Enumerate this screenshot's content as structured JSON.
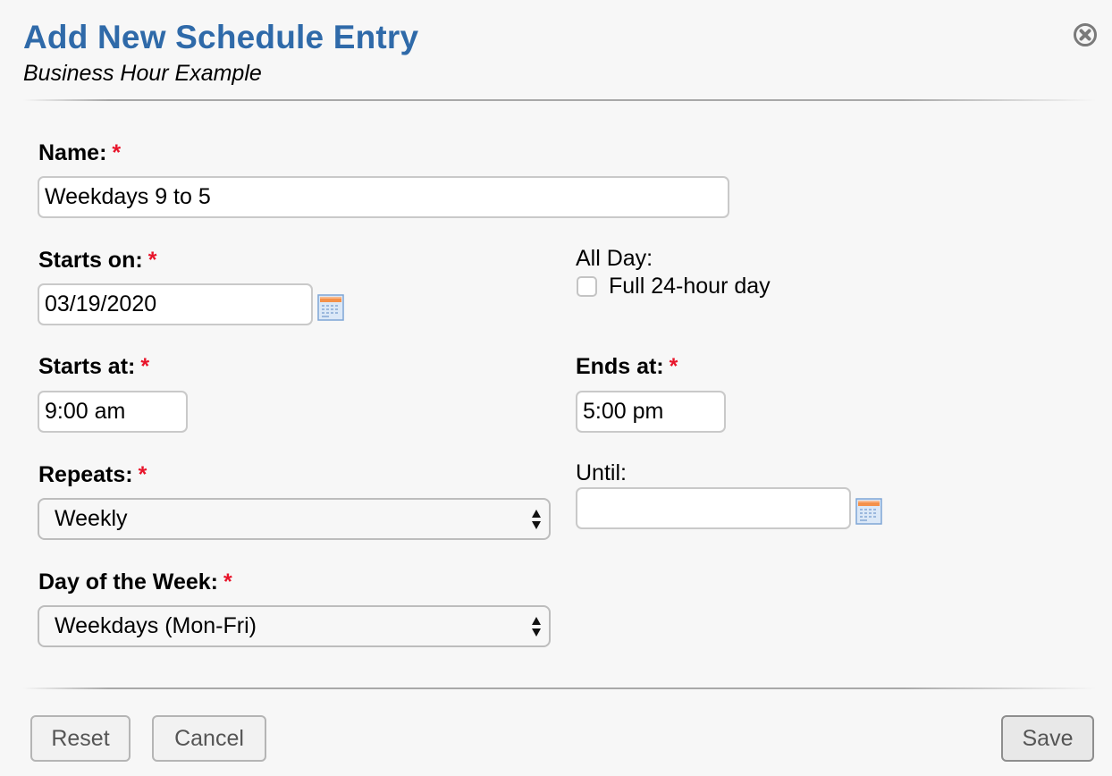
{
  "dialog": {
    "title": "Add New Schedule Entry",
    "subtitle": "Business Hour Example",
    "close_icon": "close-circle-icon"
  },
  "form": {
    "required_marker": "*",
    "name": {
      "label": "Name:",
      "value": "Weekdays 9 to 5",
      "required": true
    },
    "starts_on": {
      "label": "Starts on:",
      "value": "03/19/2020",
      "required": true,
      "icon": "calendar-icon"
    },
    "all_day": {
      "label": "All Day:",
      "checkbox_label": "Full 24-hour day",
      "checked": false
    },
    "starts_at": {
      "label": "Starts at:",
      "value": "9:00 am",
      "required": true
    },
    "ends_at": {
      "label": "Ends at:",
      "value": "5:00 pm",
      "required": true
    },
    "repeats": {
      "label": "Repeats:",
      "selected": "Weekly",
      "required": true
    },
    "until": {
      "label": "Until:",
      "value": "",
      "icon": "calendar-icon"
    },
    "day_of_week": {
      "label": "Day of the Week:",
      "selected": "Weekdays (Mon-Fri)",
      "required": true
    }
  },
  "footer": {
    "reset_label": "Reset",
    "cancel_label": "Cancel",
    "save_label": "Save"
  },
  "colors": {
    "title": "#2f6aa9",
    "required": "#e8142a",
    "background": "#f7f7f7"
  }
}
